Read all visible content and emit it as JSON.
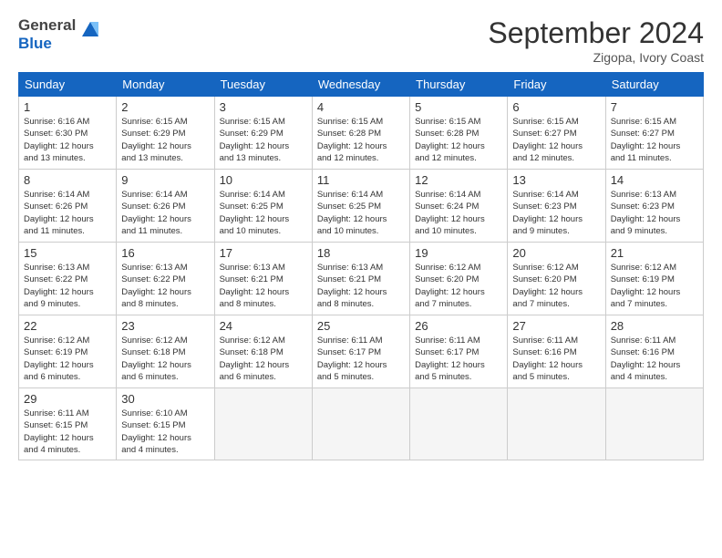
{
  "logo": {
    "line1": "General",
    "line2": "Blue"
  },
  "title": "September 2024",
  "location": "Zigopa, Ivory Coast",
  "headers": [
    "Sunday",
    "Monday",
    "Tuesday",
    "Wednesday",
    "Thursday",
    "Friday",
    "Saturday"
  ],
  "weeks": [
    [
      {
        "day": "1",
        "info": "Sunrise: 6:16 AM\nSunset: 6:30 PM\nDaylight: 12 hours\nand 13 minutes."
      },
      {
        "day": "2",
        "info": "Sunrise: 6:15 AM\nSunset: 6:29 PM\nDaylight: 12 hours\nand 13 minutes."
      },
      {
        "day": "3",
        "info": "Sunrise: 6:15 AM\nSunset: 6:29 PM\nDaylight: 12 hours\nand 13 minutes."
      },
      {
        "day": "4",
        "info": "Sunrise: 6:15 AM\nSunset: 6:28 PM\nDaylight: 12 hours\nand 12 minutes."
      },
      {
        "day": "5",
        "info": "Sunrise: 6:15 AM\nSunset: 6:28 PM\nDaylight: 12 hours\nand 12 minutes."
      },
      {
        "day": "6",
        "info": "Sunrise: 6:15 AM\nSunset: 6:27 PM\nDaylight: 12 hours\nand 12 minutes."
      },
      {
        "day": "7",
        "info": "Sunrise: 6:15 AM\nSunset: 6:27 PM\nDaylight: 12 hours\nand 11 minutes."
      }
    ],
    [
      {
        "day": "8",
        "info": "Sunrise: 6:14 AM\nSunset: 6:26 PM\nDaylight: 12 hours\nand 11 minutes."
      },
      {
        "day": "9",
        "info": "Sunrise: 6:14 AM\nSunset: 6:26 PM\nDaylight: 12 hours\nand 11 minutes."
      },
      {
        "day": "10",
        "info": "Sunrise: 6:14 AM\nSunset: 6:25 PM\nDaylight: 12 hours\nand 10 minutes."
      },
      {
        "day": "11",
        "info": "Sunrise: 6:14 AM\nSunset: 6:25 PM\nDaylight: 12 hours\nand 10 minutes."
      },
      {
        "day": "12",
        "info": "Sunrise: 6:14 AM\nSunset: 6:24 PM\nDaylight: 12 hours\nand 10 minutes."
      },
      {
        "day": "13",
        "info": "Sunrise: 6:14 AM\nSunset: 6:23 PM\nDaylight: 12 hours\nand 9 minutes."
      },
      {
        "day": "14",
        "info": "Sunrise: 6:13 AM\nSunset: 6:23 PM\nDaylight: 12 hours\nand 9 minutes."
      }
    ],
    [
      {
        "day": "15",
        "info": "Sunrise: 6:13 AM\nSunset: 6:22 PM\nDaylight: 12 hours\nand 9 minutes."
      },
      {
        "day": "16",
        "info": "Sunrise: 6:13 AM\nSunset: 6:22 PM\nDaylight: 12 hours\nand 8 minutes."
      },
      {
        "day": "17",
        "info": "Sunrise: 6:13 AM\nSunset: 6:21 PM\nDaylight: 12 hours\nand 8 minutes."
      },
      {
        "day": "18",
        "info": "Sunrise: 6:13 AM\nSunset: 6:21 PM\nDaylight: 12 hours\nand 8 minutes."
      },
      {
        "day": "19",
        "info": "Sunrise: 6:12 AM\nSunset: 6:20 PM\nDaylight: 12 hours\nand 7 minutes."
      },
      {
        "day": "20",
        "info": "Sunrise: 6:12 AM\nSunset: 6:20 PM\nDaylight: 12 hours\nand 7 minutes."
      },
      {
        "day": "21",
        "info": "Sunrise: 6:12 AM\nSunset: 6:19 PM\nDaylight: 12 hours\nand 7 minutes."
      }
    ],
    [
      {
        "day": "22",
        "info": "Sunrise: 6:12 AM\nSunset: 6:19 PM\nDaylight: 12 hours\nand 6 minutes."
      },
      {
        "day": "23",
        "info": "Sunrise: 6:12 AM\nSunset: 6:18 PM\nDaylight: 12 hours\nand 6 minutes."
      },
      {
        "day": "24",
        "info": "Sunrise: 6:12 AM\nSunset: 6:18 PM\nDaylight: 12 hours\nand 6 minutes."
      },
      {
        "day": "25",
        "info": "Sunrise: 6:11 AM\nSunset: 6:17 PM\nDaylight: 12 hours\nand 5 minutes."
      },
      {
        "day": "26",
        "info": "Sunrise: 6:11 AM\nSunset: 6:17 PM\nDaylight: 12 hours\nand 5 minutes."
      },
      {
        "day": "27",
        "info": "Sunrise: 6:11 AM\nSunset: 6:16 PM\nDaylight: 12 hours\nand 5 minutes."
      },
      {
        "day": "28",
        "info": "Sunrise: 6:11 AM\nSunset: 6:16 PM\nDaylight: 12 hours\nand 4 minutes."
      }
    ],
    [
      {
        "day": "29",
        "info": "Sunrise: 6:11 AM\nSunset: 6:15 PM\nDaylight: 12 hours\nand 4 minutes."
      },
      {
        "day": "30",
        "info": "Sunrise: 6:10 AM\nSunset: 6:15 PM\nDaylight: 12 hours\nand 4 minutes."
      },
      {
        "day": "",
        "info": ""
      },
      {
        "day": "",
        "info": ""
      },
      {
        "day": "",
        "info": ""
      },
      {
        "day": "",
        "info": ""
      },
      {
        "day": "",
        "info": ""
      }
    ]
  ]
}
